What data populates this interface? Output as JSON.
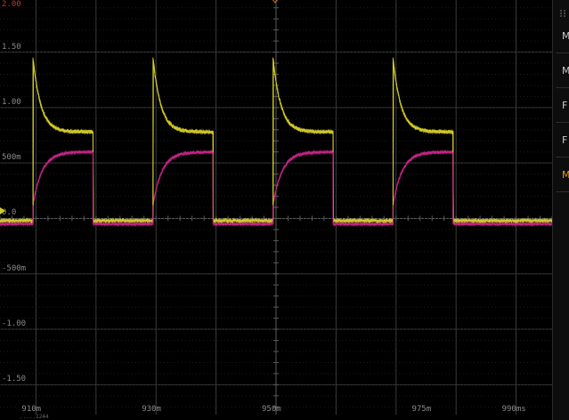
{
  "chart_data": {
    "type": "line",
    "title": "",
    "xlabel": "",
    "ylabel": "",
    "x_unit": "ms",
    "xlim": [
      904,
      996
    ],
    "ylim": [
      -1.77,
      1.97
    ],
    "y_ticks": [
      1.5,
      1.0,
      0.5,
      0.0,
      -0.5,
      -1.0,
      -1.5
    ],
    "y_tick_labels": [
      "1.50",
      "1.00",
      "500m",
      "0.0",
      "-500m",
      "-1.00",
      "-1.50"
    ],
    "y_top_label": "2.00",
    "x_ticks": [
      910,
      930,
      950,
      975,
      990
    ],
    "x_tick_labels": [
      "910m",
      "930m",
      "950m",
      "975m",
      "990ms"
    ],
    "grid": true,
    "pulse_starts": [
      909.5,
      929.5,
      949.5,
      969.5
    ],
    "pulse_width": 10,
    "series": [
      {
        "color": "#d2cc2a",
        "high_level": 0.78,
        "peak": 1.45,
        "low_level": -0.02
      },
      {
        "color": "#c8248a",
        "high_level": 0.6,
        "start_level": 0.12,
        "low_level": -0.05
      }
    ]
  },
  "side_panel": {
    "items": [
      "M",
      "M",
      "F",
      "F",
      "M"
    ],
    "active_index": 4
  },
  "status": {
    "text": ".....1244"
  },
  "colors": {
    "background": "#000000",
    "grid": "#3a3a3a",
    "axis": "#5a5a5a",
    "trigger": "#e07a10",
    "accent": "#e09a2a"
  }
}
